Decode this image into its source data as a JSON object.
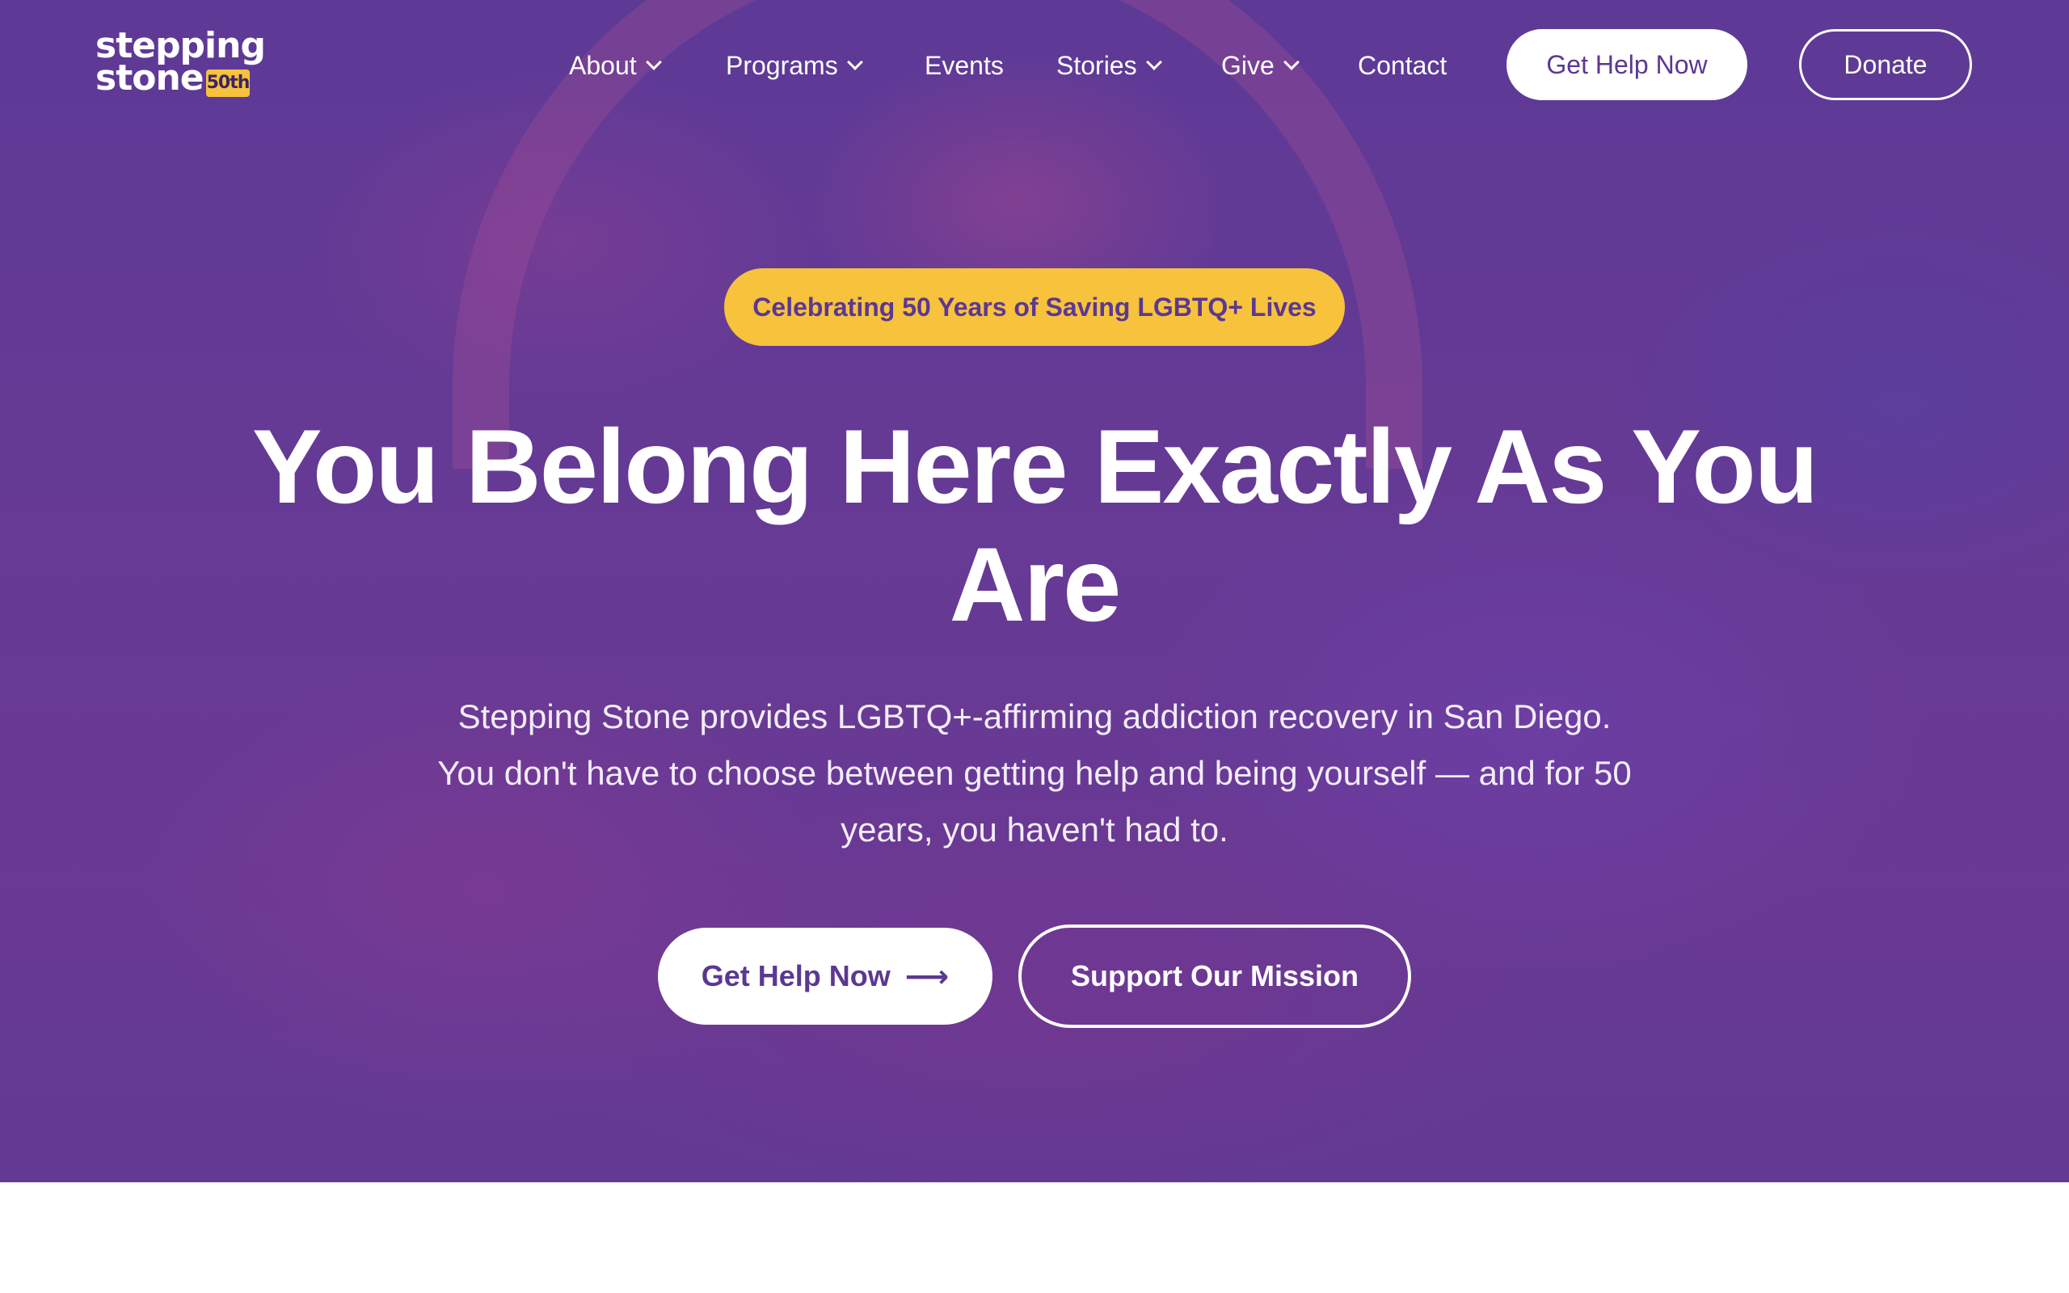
{
  "brand": {
    "logo_line1": "stepping",
    "logo_line2": "stone",
    "logo_badge": "50th",
    "accent_color": "#f7c23c",
    "primary_color": "#5b3893"
  },
  "nav": {
    "items": [
      {
        "label": "About",
        "has_dropdown": true,
        "icon": "chevron-down-icon"
      },
      {
        "label": "Programs",
        "has_dropdown": true,
        "icon": "chevron-down-icon"
      },
      {
        "label": "Events",
        "has_dropdown": false
      },
      {
        "label": "Stories",
        "has_dropdown": true,
        "icon": "chevron-down-icon"
      },
      {
        "label": "Give",
        "has_dropdown": true,
        "icon": "chevron-down-icon"
      },
      {
        "label": "Contact",
        "has_dropdown": false
      }
    ],
    "cta_help": "Get Help Now",
    "cta_donate": "Donate"
  },
  "hero": {
    "badge": "Celebrating 50 Years of Saving LGBTQ+ Lives",
    "headline": "You Belong Here Exactly As You Are",
    "subtext": "Stepping Stone provides LGBTQ+-affirming addiction recovery in San Diego. You don't have to choose between getting help and being yourself — and for 50 years, you haven't had to.",
    "primary_button": "Get Help Now",
    "primary_button_icon": "arrow-right-icon",
    "secondary_button": "Support Our Mission"
  }
}
